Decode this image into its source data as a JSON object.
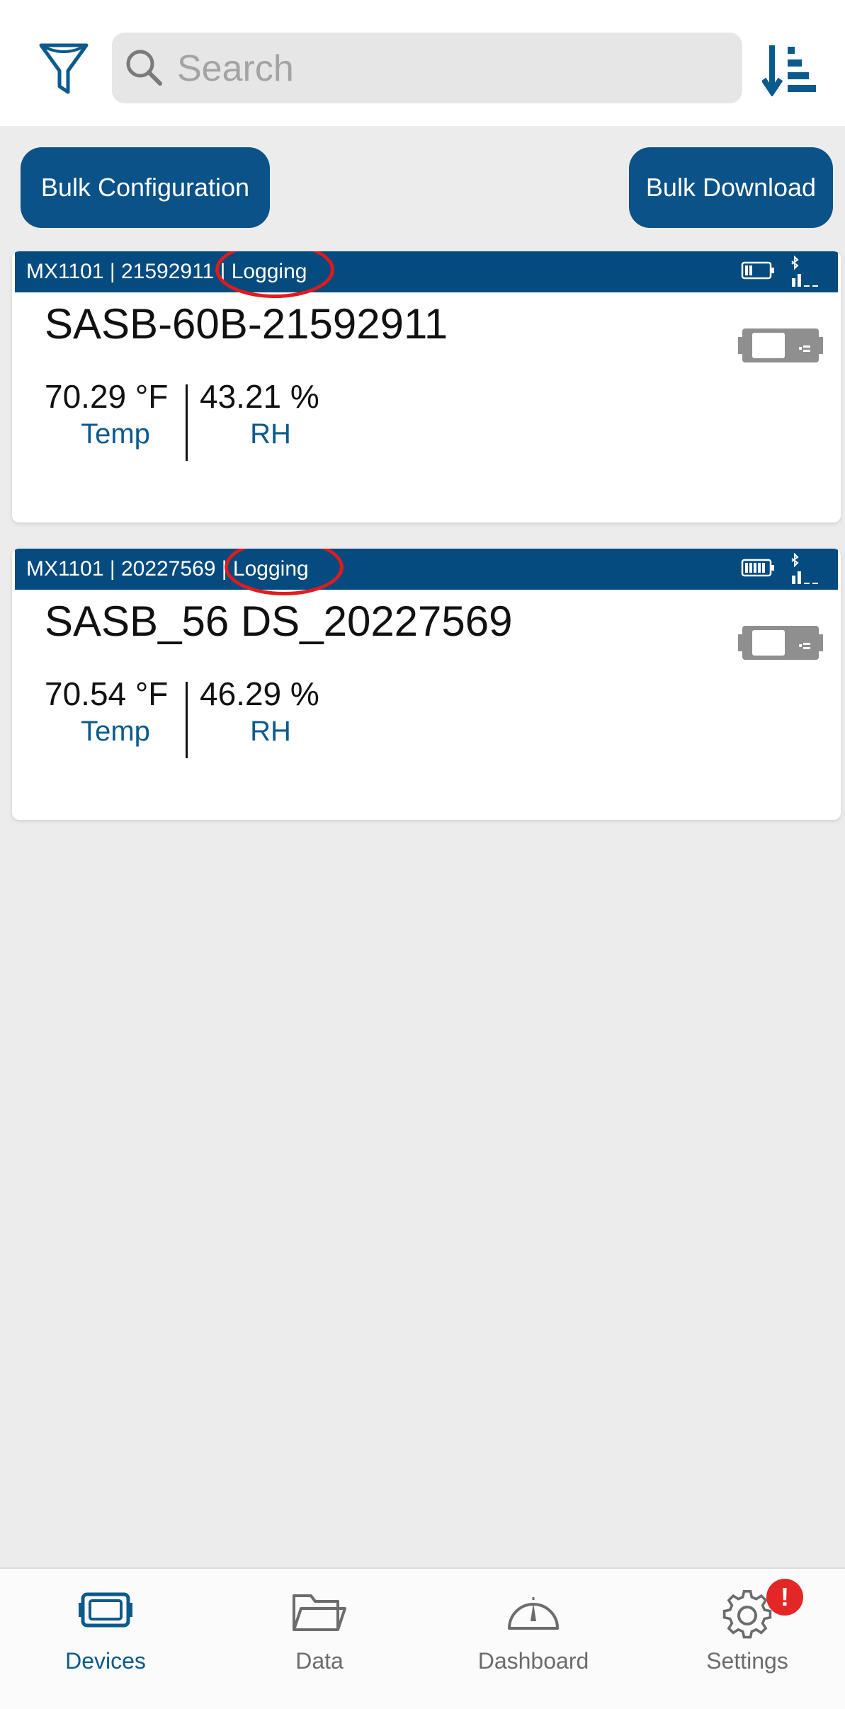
{
  "search": {
    "placeholder": "Search"
  },
  "actions": {
    "bulk_configuration": "Bulk Configuration",
    "bulk_download": "Bulk Download"
  },
  "devices": [
    {
      "model": "MX1101",
      "serial": "21592911",
      "status": "Logging",
      "header_prefix": "MX1101 | 21592911 ",
      "header_status": "| Logging",
      "name": "SASB-60B-21592911",
      "readings": [
        {
          "value": "70.29 °F",
          "label": "Temp"
        },
        {
          "value": "43.21 %",
          "label": "RH"
        }
      ],
      "battery_level": "low",
      "status_highlighted": true
    },
    {
      "model": "MX1101",
      "serial": "20227569",
      "status": "Logging",
      "header_prefix": "MX1101 | 20227569 ",
      "header_status": "| Logging",
      "name": "SASB_56 DS_20227569",
      "readings": [
        {
          "value": "70.54 °F",
          "label": "Temp"
        },
        {
          "value": "46.29 %",
          "label": "RH"
        }
      ],
      "battery_level": "full",
      "status_highlighted": true
    }
  ],
  "nav": {
    "items": [
      {
        "label": "Devices",
        "icon": "device-icon",
        "active": true
      },
      {
        "label": "Data",
        "icon": "folder-icon",
        "active": false
      },
      {
        "label": "Dashboard",
        "icon": "gauge-icon",
        "active": false
      },
      {
        "label": "Settings",
        "icon": "gear-icon",
        "active": false,
        "badge": "!"
      }
    ]
  },
  "colors": {
    "primary": "#0a5287",
    "header_bar": "#054b7f",
    "highlight_ring": "#e01b1b",
    "badge": "#e32626",
    "background": "#ececec"
  }
}
